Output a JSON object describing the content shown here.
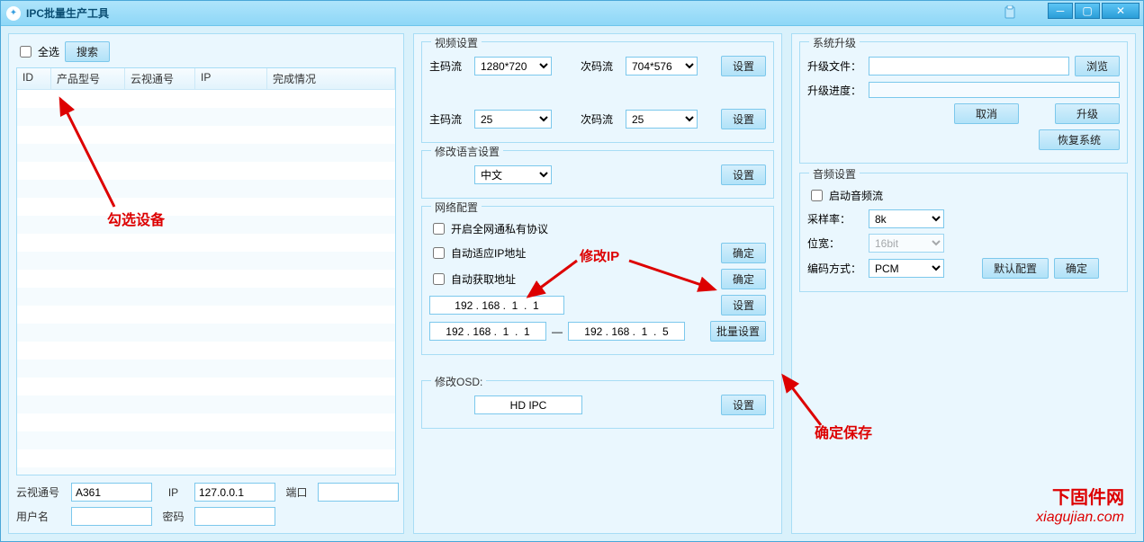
{
  "window": {
    "title": "IPC批量生产工具"
  },
  "left": {
    "select_all": "全选",
    "search_btn": "搜索",
    "cols": {
      "id": "ID",
      "model": "产品型号",
      "cloud": "云视通号",
      "ip": "IP",
      "status": "完成情况"
    },
    "annot": "勾选设备",
    "bottom": {
      "cloud_label": "云视通号",
      "cloud_val": "A361",
      "ip_label": "IP",
      "ip_val": "127.0.0.1",
      "port_label": "端口",
      "port_val": "",
      "user_label": "用户名",
      "user_val": "",
      "pwd_label": "密码",
      "pwd_val": ""
    }
  },
  "mid": {
    "video": {
      "legend": "视频设置",
      "main_label": "主码流",
      "main_val": "1280*720",
      "sub_label": "次码流",
      "sub_val": "704*576",
      "set_btn": "设置",
      "main2_label": "主码流",
      "main2_val": "25",
      "sub2_label": "次码流",
      "sub2_val": "25",
      "set2_btn": "设置"
    },
    "lang": {
      "legend": "修改语言设置",
      "val": "中文",
      "set_btn": "设置"
    },
    "net": {
      "legend": "网络配置",
      "chk1": "开启全网通私有协议",
      "chk2": "自动适应IP地址",
      "chk3": "自动获取地址",
      "ip1": "192 . 168 .  1  .  1",
      "range_a": "192 . 168 .  1  .  1",
      "range_b": "192 . 168 .  1  .  5",
      "ok_btn": "确定",
      "set_btn": "设置",
      "batch_btn": "批量设置",
      "annot_ip": "修改IP"
    },
    "osd": {
      "legend": "修改OSD:",
      "val": "HD IPC",
      "set_btn": "设置"
    }
  },
  "right": {
    "upgrade": {
      "legend": "系统升级",
      "file_label": "升级文件：",
      "browse_btn": "浏览",
      "prog_label": "升级进度：",
      "cancel_btn": "取消",
      "upgrade_btn": "升级",
      "restore_btn": "恢复系统"
    },
    "audio": {
      "legend": "音频设置",
      "enable": "启动音频流",
      "rate_label": "采样率：",
      "rate_val": "8k",
      "bits_label": "位宽：",
      "bits_val": "16bit",
      "enc_label": "编码方式：",
      "enc_val": "PCM",
      "default_btn": "默认配置",
      "ok_btn": "确定"
    },
    "annot_save": "确定保存",
    "watermark_l1": "下固件网",
    "watermark_l2": "xiagujian.com"
  }
}
